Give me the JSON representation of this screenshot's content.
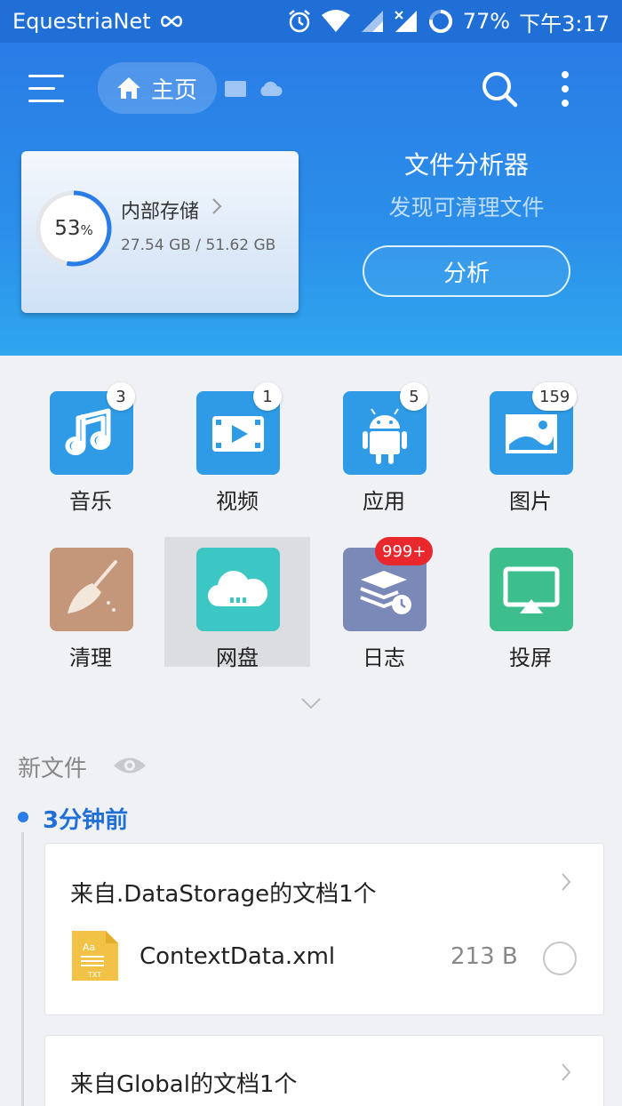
{
  "status_bar": {
    "carrier": "EquestriaNet",
    "battery": "77%",
    "time": "下午3:17"
  },
  "header": {
    "home_label": "主页",
    "storage": {
      "percent": "53",
      "percent_unit": "%",
      "name": "内部存储",
      "size": "27.54 GB / 51.62 GB",
      "used_fraction": 0.53
    },
    "analyzer": {
      "title": "文件分析器",
      "subtitle": "发现可清理文件",
      "button": "分析"
    }
  },
  "categories": [
    {
      "label": "音乐",
      "badge": "3",
      "icon": "music-note-icon",
      "color": "#2f9be6"
    },
    {
      "label": "视频",
      "badge": "1",
      "icon": "video-play-icon",
      "color": "#2f9be6"
    },
    {
      "label": "应用",
      "badge": "5",
      "icon": "android-icon",
      "color": "#2f9be6"
    },
    {
      "label": "图片",
      "badge": "159",
      "icon": "image-icon",
      "color": "#2f9be6"
    },
    {
      "label": "清理",
      "badge": "",
      "icon": "broom-icon",
      "color": "#c4967a"
    },
    {
      "label": "网盘",
      "badge": "",
      "icon": "cloud-icon",
      "color": "#3cc6c4"
    },
    {
      "label": "日志",
      "badge": "999+",
      "icon": "log-stack-icon",
      "color": "#7b89b8"
    },
    {
      "label": "投屏",
      "badge": "",
      "icon": "cast-screen-icon",
      "color": "#3cbf8c"
    }
  ],
  "recent": {
    "title": "新文件",
    "time_label": "3分钟前",
    "groups": [
      {
        "title": "来自.DataStorage的文档1个",
        "file": {
          "name": "ContextData.xml",
          "size": "213 B",
          "icon_text": "Aa",
          "icon_ext": "TXT"
        }
      },
      {
        "title": "来自Global的文档1个"
      }
    ]
  },
  "colors": {
    "primary": "#1f6fd6",
    "badge_red": "#e8282d"
  }
}
